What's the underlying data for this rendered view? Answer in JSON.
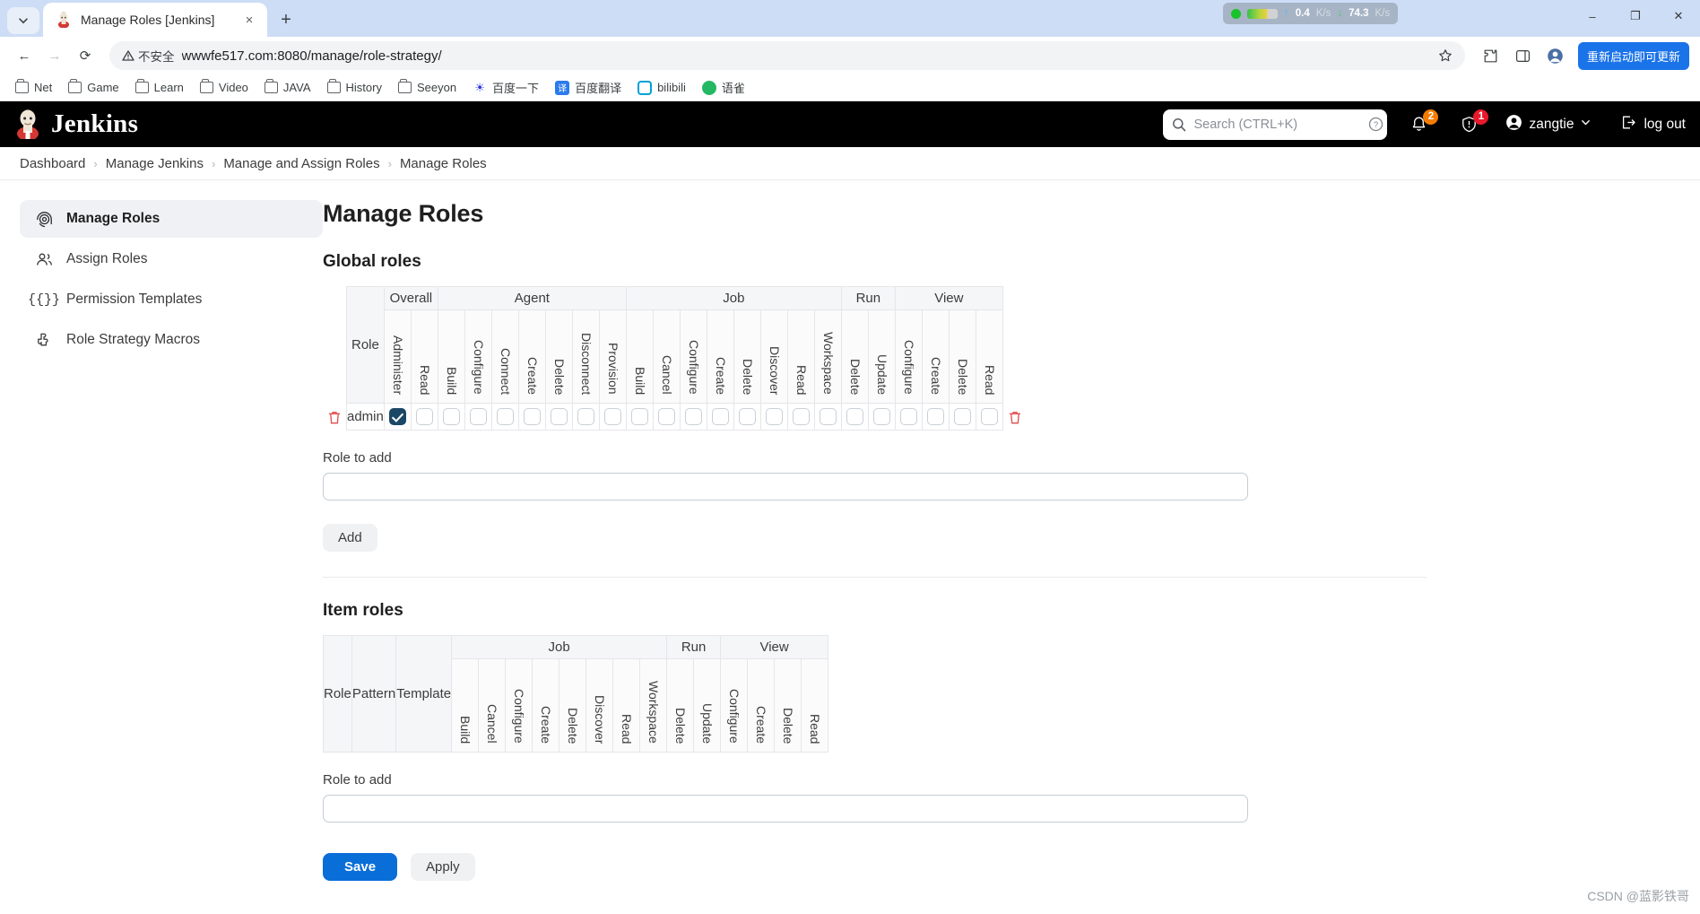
{
  "browser": {
    "tab": {
      "title": "Manage Roles [Jenkins]",
      "favicon": "jenkins-butler-icon",
      "close_label": "×"
    },
    "new_tab_label": "+",
    "tab_search_label": "⌄",
    "nav": {
      "back": "←",
      "forward": "→",
      "reload": "⟳"
    },
    "omnibox": {
      "security_label": "不安全",
      "url": "wwwfe517.com:8080/manage/role-strategy/",
      "star_icon": "bookmark-star-icon",
      "extensions_icon": "puzzle-icon",
      "sidepanel_icon": "side-panel-icon",
      "profile_icon": "profile-avatar-icon"
    },
    "update_button": "重新启动即可更新",
    "net_speed": {
      "up": "0.4",
      "up_unit": "K/s",
      "down": "74.3",
      "down_unit": "K/s"
    },
    "window_controls": {
      "minimize": "–",
      "maximize": "❐",
      "close": "✕"
    },
    "bookmarks": [
      {
        "label": "Net",
        "icon": "folder-icon"
      },
      {
        "label": "Game",
        "icon": "folder-icon"
      },
      {
        "label": "Learn",
        "icon": "folder-icon"
      },
      {
        "label": "Video",
        "icon": "folder-icon"
      },
      {
        "label": "JAVA",
        "icon": "folder-icon"
      },
      {
        "label": "History",
        "icon": "folder-icon"
      },
      {
        "label": "Seeyon",
        "icon": "folder-icon"
      },
      {
        "label": "百度一下",
        "icon": "baidu-icon",
        "color": "#2932e1"
      },
      {
        "label": "百度翻译",
        "icon": "baidu-translate-icon",
        "color": "#2b7bed",
        "glyph": "译"
      },
      {
        "label": "bilibili",
        "icon": "bilibili-icon",
        "color": "#00a1d6"
      },
      {
        "label": "语雀",
        "icon": "yuque-icon",
        "color": "#25b864"
      }
    ]
  },
  "jenkins_header": {
    "brand": "Jenkins",
    "logo_icon": "jenkins-butler-logo",
    "search": {
      "placeholder": "Search (CTRL+K)",
      "value": "",
      "icon": "search-icon",
      "help_icon": "help-circle-icon"
    },
    "notifications": {
      "icon": "bell-icon",
      "count": "2",
      "color": "#f57c00"
    },
    "security": {
      "icon": "shield-alert-icon",
      "count": "1",
      "color": "#e8192c"
    },
    "user": {
      "name": "zangtie",
      "icon": "user-circle-icon",
      "chevron": "chevron-down-icon"
    },
    "logout": {
      "label": "log out",
      "icon": "logout-icon"
    }
  },
  "breadcrumb": {
    "separator": "›",
    "items": [
      "Dashboard",
      "Manage Jenkins",
      "Manage and Assign Roles",
      "Manage Roles"
    ]
  },
  "sidebar": {
    "items": [
      {
        "label": "Manage Roles",
        "icon": "fingerprint-icon",
        "active": true
      },
      {
        "label": "Assign Roles",
        "icon": "people-icon",
        "active": false
      },
      {
        "label": "Permission Templates",
        "icon": "braces-icon",
        "active": false
      },
      {
        "label": "Role Strategy Macros",
        "icon": "puzzle-piece-icon",
        "active": false
      }
    ]
  },
  "main": {
    "page_title": "Manage Roles",
    "global_roles": {
      "section_title": "Global roles",
      "role_header": "Role",
      "groups": [
        {
          "label": "Overall",
          "span": 2
        },
        {
          "label": "Agent",
          "span": 7
        },
        {
          "label": "Job",
          "span": 8
        },
        {
          "label": "Run",
          "span": 2
        },
        {
          "label": "View",
          "span": 4
        }
      ],
      "columns": [
        "Administer",
        "Read",
        "Build",
        "Configure",
        "Connect",
        "Create",
        "Delete",
        "Disconnect",
        "Provision",
        "Build",
        "Cancel",
        "Configure",
        "Create",
        "Delete",
        "Discover",
        "Read",
        "Workspace",
        "Delete",
        "Update",
        "Configure",
        "Create",
        "Delete",
        "Read"
      ],
      "rows": [
        {
          "name": "admin",
          "delete_icon": "trash-icon",
          "checked": [
            true,
            false,
            false,
            false,
            false,
            false,
            false,
            false,
            false,
            false,
            false,
            false,
            false,
            false,
            false,
            false,
            false,
            false,
            false,
            false,
            false,
            false,
            false
          ]
        }
      ],
      "role_to_add_label": "Role to add",
      "role_to_add_value": "",
      "add_button": "Add"
    },
    "item_roles": {
      "section_title": "Item roles",
      "fixed_headers": [
        "Role",
        "Pattern",
        "Template"
      ],
      "groups": [
        {
          "label": "Job",
          "span": 8
        },
        {
          "label": "Run",
          "span": 2
        },
        {
          "label": "View",
          "span": 4
        }
      ],
      "columns": [
        "Build",
        "Cancel",
        "Configure",
        "Create",
        "Delete",
        "Discover",
        "Read",
        "Workspace",
        "Delete",
        "Update",
        "Configure",
        "Create",
        "Delete",
        "Read"
      ],
      "rows": [],
      "role_to_add_label": "Role to add",
      "role_to_add_value": ""
    },
    "footer": {
      "save_label": "Save",
      "apply_label": "Apply"
    }
  },
  "watermark": "CSDN @蓝影铁哥"
}
